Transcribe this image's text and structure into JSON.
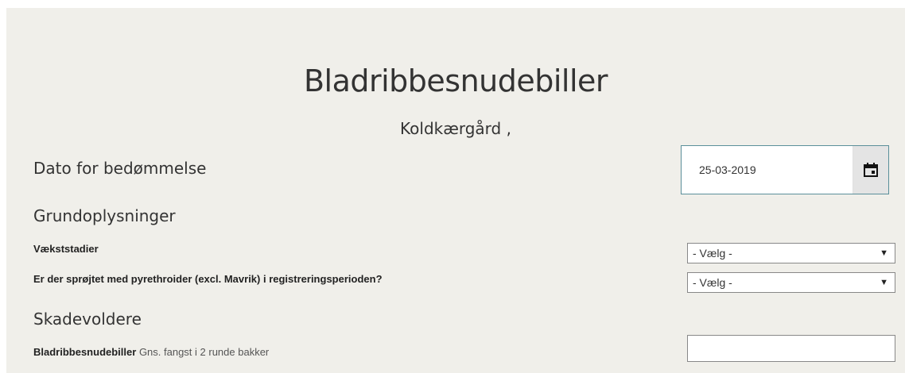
{
  "form": {
    "title": "Bladribbesnudebiller",
    "subtitle": "Koldkærgård ,",
    "date_label": "Dato for bedømmelse",
    "date_value": "25-03-2019",
    "section_basic": "Grundoplysninger",
    "growth_stage_label": "Vækststadier",
    "growth_stage_value": "- Vælg -",
    "sprayed_label": "Er der sprøjtet med pyrethroider (excl. Mavrik) i registreringsperioden?",
    "sprayed_value": "- Vælg -",
    "section_pests": "Skadevoldere",
    "pest_label": "Bladribbesnudebiller",
    "pest_hint": "Gns. fangst i 2 runde bakker",
    "pest_value": ""
  },
  "icons": {
    "calendar": "calendar-icon",
    "dropdown": "chevron-down-icon"
  },
  "colors": {
    "panel_background": "#f0efea",
    "date_border": "#5a8f9a"
  }
}
